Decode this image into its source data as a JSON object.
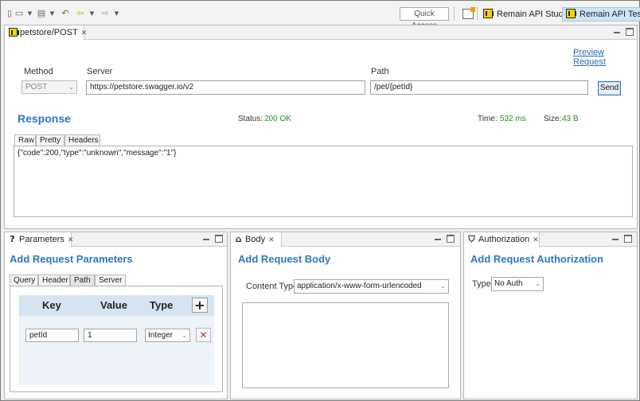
{
  "toolbar": {
    "icons": [
      "new-file-icon",
      "save-icon",
      "undo-edit-icon",
      "back-arrow-icon",
      "forward-arrow-icon"
    ],
    "quick_access": "Quick Access",
    "perspectives": [
      {
        "label": "Remain API Studio",
        "active": false
      },
      {
        "label": "Remain API Test",
        "active": true
      }
    ]
  },
  "editor": {
    "tab_label": "petstore/POST",
    "preview_link": "Preview Request",
    "method_label": "Method",
    "method_value": "POST",
    "server_label": "Server",
    "server_value": "https://petstore.swagger.io/v2",
    "path_label": "Path",
    "path_value": "/pet/{petId}",
    "send_label": "Send"
  },
  "response": {
    "title": "Response",
    "status_label": "Status:",
    "status_value": "200 OK",
    "time_label": "Time:",
    "time_value": "532 ms",
    "size_label": "Size:",
    "size_value": "43 B",
    "tabs": [
      "Raw",
      "Pretty",
      "Headers"
    ],
    "active_tab": "Raw",
    "body": "{\"code\":200,\"type\":\"unknown\",\"message\":\"1\"}"
  },
  "parameters": {
    "tab_label": "Parameters",
    "tab_icon": "question-icon",
    "title": "Add Request Parameters",
    "subtabs": [
      "Query",
      "Header",
      "Path",
      "Server"
    ],
    "active_subtab": "Path",
    "columns": [
      "Key",
      "Value",
      "Type"
    ],
    "rows": [
      {
        "key": "petId",
        "value": "1",
        "type": "Integer"
      }
    ]
  },
  "body_view": {
    "tab_label": "Body",
    "tab_icon": "package-icon",
    "title": "Add Request Body",
    "content_type_label": "Content Type",
    "content_type_value": "application/x-www-form-urlencoded"
  },
  "auth_view": {
    "tab_label": "Authorization",
    "tab_icon": "shield-icon",
    "title": "Add Request Authorization",
    "type_label": "Type",
    "type_value": "No Auth"
  },
  "colors": {
    "accent": "#2c78c2",
    "status_ok": "#1f8f1f",
    "link": "#2a6ab5",
    "delete": "#d23a3a"
  }
}
